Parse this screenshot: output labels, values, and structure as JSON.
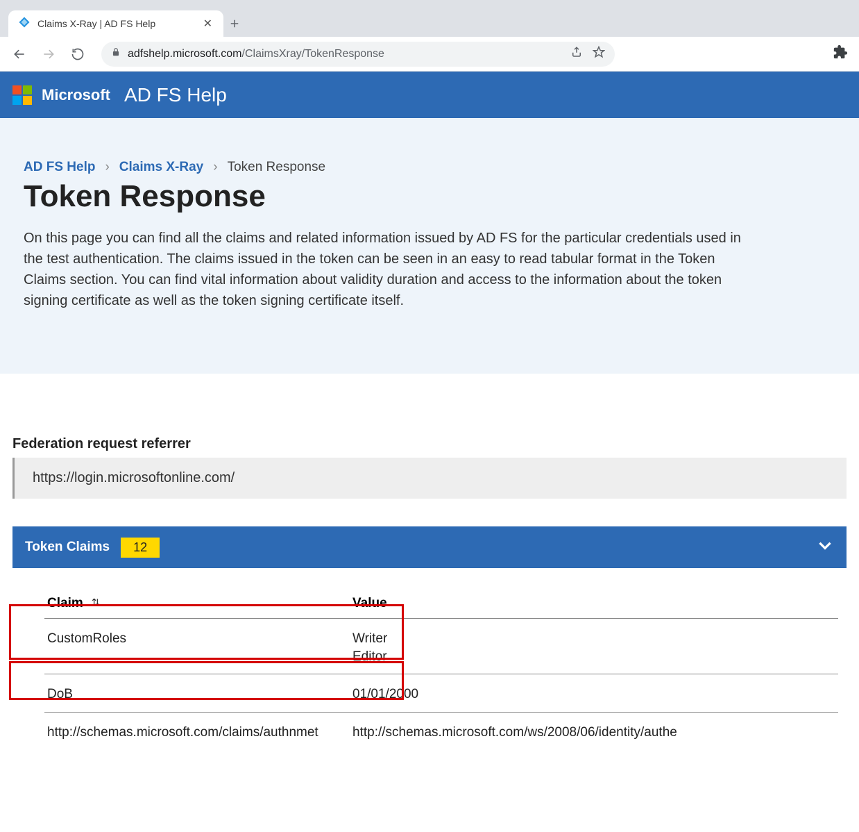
{
  "browser": {
    "tab_title": "Claims X-Ray | AD FS Help",
    "url_host": "adfshelp.microsoft.com",
    "url_path": "/ClaimsXray/TokenResponse"
  },
  "header": {
    "brand": "Microsoft",
    "site": "AD FS Help"
  },
  "breadcrumb": {
    "item1": "AD FS Help",
    "item2": "Claims X-Ray",
    "item3": "Token Response"
  },
  "page": {
    "title": "Token Response",
    "description": "On this page you can find all the claims and related information issued by AD FS for the particular credentials used in the test authentication. The claims issued in the token can be seen in an easy to read tabular format in the Token Claims section. You can find vital information about validity duration and access to the information about the token signing certificate as well as the token signing certificate itself."
  },
  "referrer": {
    "label": "Federation request referrer",
    "value": "https://login.microsoftonline.com/"
  },
  "claims": {
    "header": "Token Claims",
    "count": "12",
    "columns": {
      "claim": "Claim",
      "value": "Value"
    },
    "rows": [
      {
        "claim": "CustomRoles",
        "value": "Writer\nEditor"
      },
      {
        "claim": "DoB",
        "value": "01/01/2000"
      },
      {
        "claim": "http://schemas.microsoft.com/claims/authnmet",
        "value": "http://schemas.microsoft.com/ws/2008/06/identity/authe"
      }
    ]
  }
}
